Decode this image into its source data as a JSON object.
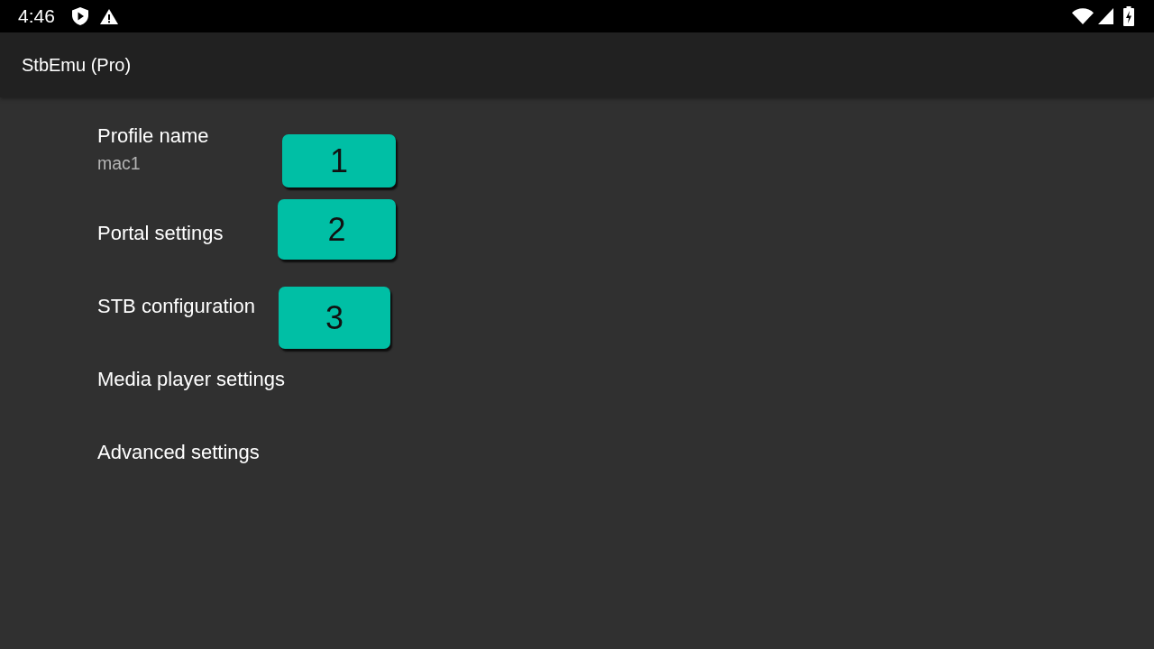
{
  "status_bar": {
    "time": "4:46"
  },
  "app_bar": {
    "title": "StbEmu (Pro)"
  },
  "settings": [
    {
      "title": "Profile name",
      "summary": "mac1",
      "callout": "1"
    },
    {
      "title": "Portal settings",
      "callout": "2"
    },
    {
      "title": "STB configuration",
      "callout": "3"
    },
    {
      "title": "Media player settings"
    },
    {
      "title": "Advanced settings"
    }
  ]
}
